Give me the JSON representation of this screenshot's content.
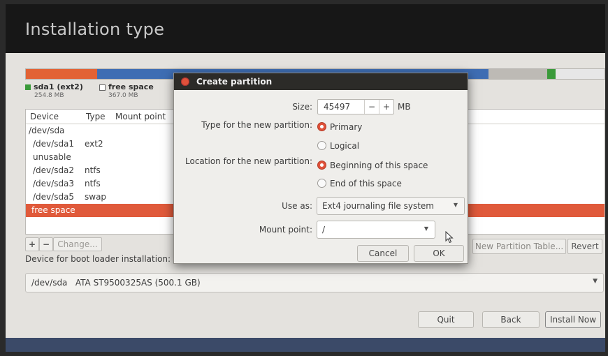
{
  "header": {
    "title": "Installation type"
  },
  "colors": {
    "accent": "#e05a3b",
    "ntfs": "#3e6db3",
    "ext2": "#3a9a3a"
  },
  "legend": [
    {
      "label": "sda1 (ext2)",
      "size": "254.8 MB",
      "color": "#3a9a3a"
    },
    {
      "label": "free space",
      "size": "367.0 MB",
      "color": "#ffffff"
    }
  ],
  "table": {
    "columns": [
      "Device",
      "Type",
      "Mount point"
    ],
    "rows": [
      {
        "device": "/dev/sda",
        "type": ""
      },
      {
        "device": "/dev/sda1",
        "type": "ext2"
      },
      {
        "device": "unusable",
        "type": ""
      },
      {
        "device": "/dev/sda2",
        "type": "ntfs"
      },
      {
        "device": "/dev/sda3",
        "type": "ntfs"
      },
      {
        "device": "/dev/sda5",
        "type": "swap"
      },
      {
        "device": "free space",
        "type": ""
      }
    ]
  },
  "table_buttons": {
    "add": "+",
    "remove": "−",
    "change": "Change...",
    "new_table": "New Partition Table...",
    "revert": "Revert"
  },
  "boot": {
    "label": "Device for boot loader installation:",
    "device": "/dev/sda",
    "model": "ATA ST9500325AS (500.1 GB)"
  },
  "footer": {
    "quit": "Quit",
    "back": "Back",
    "install": "Install Now"
  },
  "dialog": {
    "title": "Create partition",
    "size_label": "Size:",
    "size_value": "45497",
    "size_minus": "−",
    "size_plus": "+",
    "size_unit": "MB",
    "type_label": "Type for the new partition:",
    "type_primary": "Primary",
    "type_logical": "Logical",
    "location_label": "Location for the new partition:",
    "location_beginning": "Beginning of this space",
    "location_end": "End of this space",
    "useas_label": "Use as:",
    "useas_value": "Ext4 journaling file system",
    "mount_label": "Mount point:",
    "mount_value": "/",
    "cancel": "Cancel",
    "ok": "OK"
  }
}
